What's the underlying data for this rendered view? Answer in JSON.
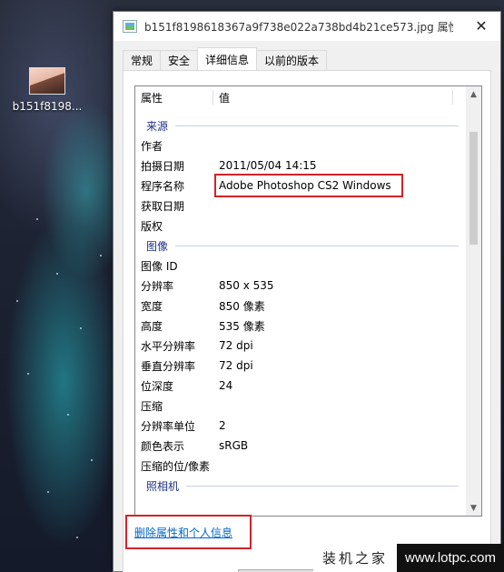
{
  "desktop": {
    "icon_label": "b151f8198..."
  },
  "window": {
    "title": "b151f8198618367a9f738e022a738bd4b21ce573.jpg 属性",
    "close_glyph": "✕"
  },
  "tabs": [
    {
      "label": "常规"
    },
    {
      "label": "安全"
    },
    {
      "label": "详细信息"
    },
    {
      "label": "以前的版本"
    }
  ],
  "list": {
    "header_name": "属性",
    "header_value": "值",
    "groups": {
      "source": "来源",
      "image": "图像",
      "camera": "照相机"
    },
    "source_rows": [
      {
        "name": "作者",
        "value": ""
      },
      {
        "name": "拍摄日期",
        "value": "2011/05/04 14:15"
      },
      {
        "name": "程序名称",
        "value": "Adobe Photoshop CS2 Windows"
      },
      {
        "name": "获取日期",
        "value": ""
      },
      {
        "name": "版权",
        "value": ""
      }
    ],
    "image_rows": [
      {
        "name": "图像 ID",
        "value": ""
      },
      {
        "name": "分辨率",
        "value": "850 x 535"
      },
      {
        "name": "宽度",
        "value": "850 像素"
      },
      {
        "name": "高度",
        "value": "535 像素"
      },
      {
        "name": "水平分辨率",
        "value": "72 dpi"
      },
      {
        "name": "垂直分辨率",
        "value": "72 dpi"
      },
      {
        "name": "位深度",
        "value": "24"
      },
      {
        "name": "压缩",
        "value": ""
      },
      {
        "name": "分辨率单位",
        "value": "2"
      },
      {
        "name": "颜色表示",
        "value": "sRGB"
      },
      {
        "name": "压缩的位/像素",
        "value": ""
      }
    ]
  },
  "remove_link": "删除属性和个人信息",
  "watermark": {
    "left": "装机之家",
    "right": "www.lotpc.com"
  },
  "colors": {
    "highlight": "#d2232a",
    "group_text": "#1e3287",
    "link": "#0066cc"
  }
}
